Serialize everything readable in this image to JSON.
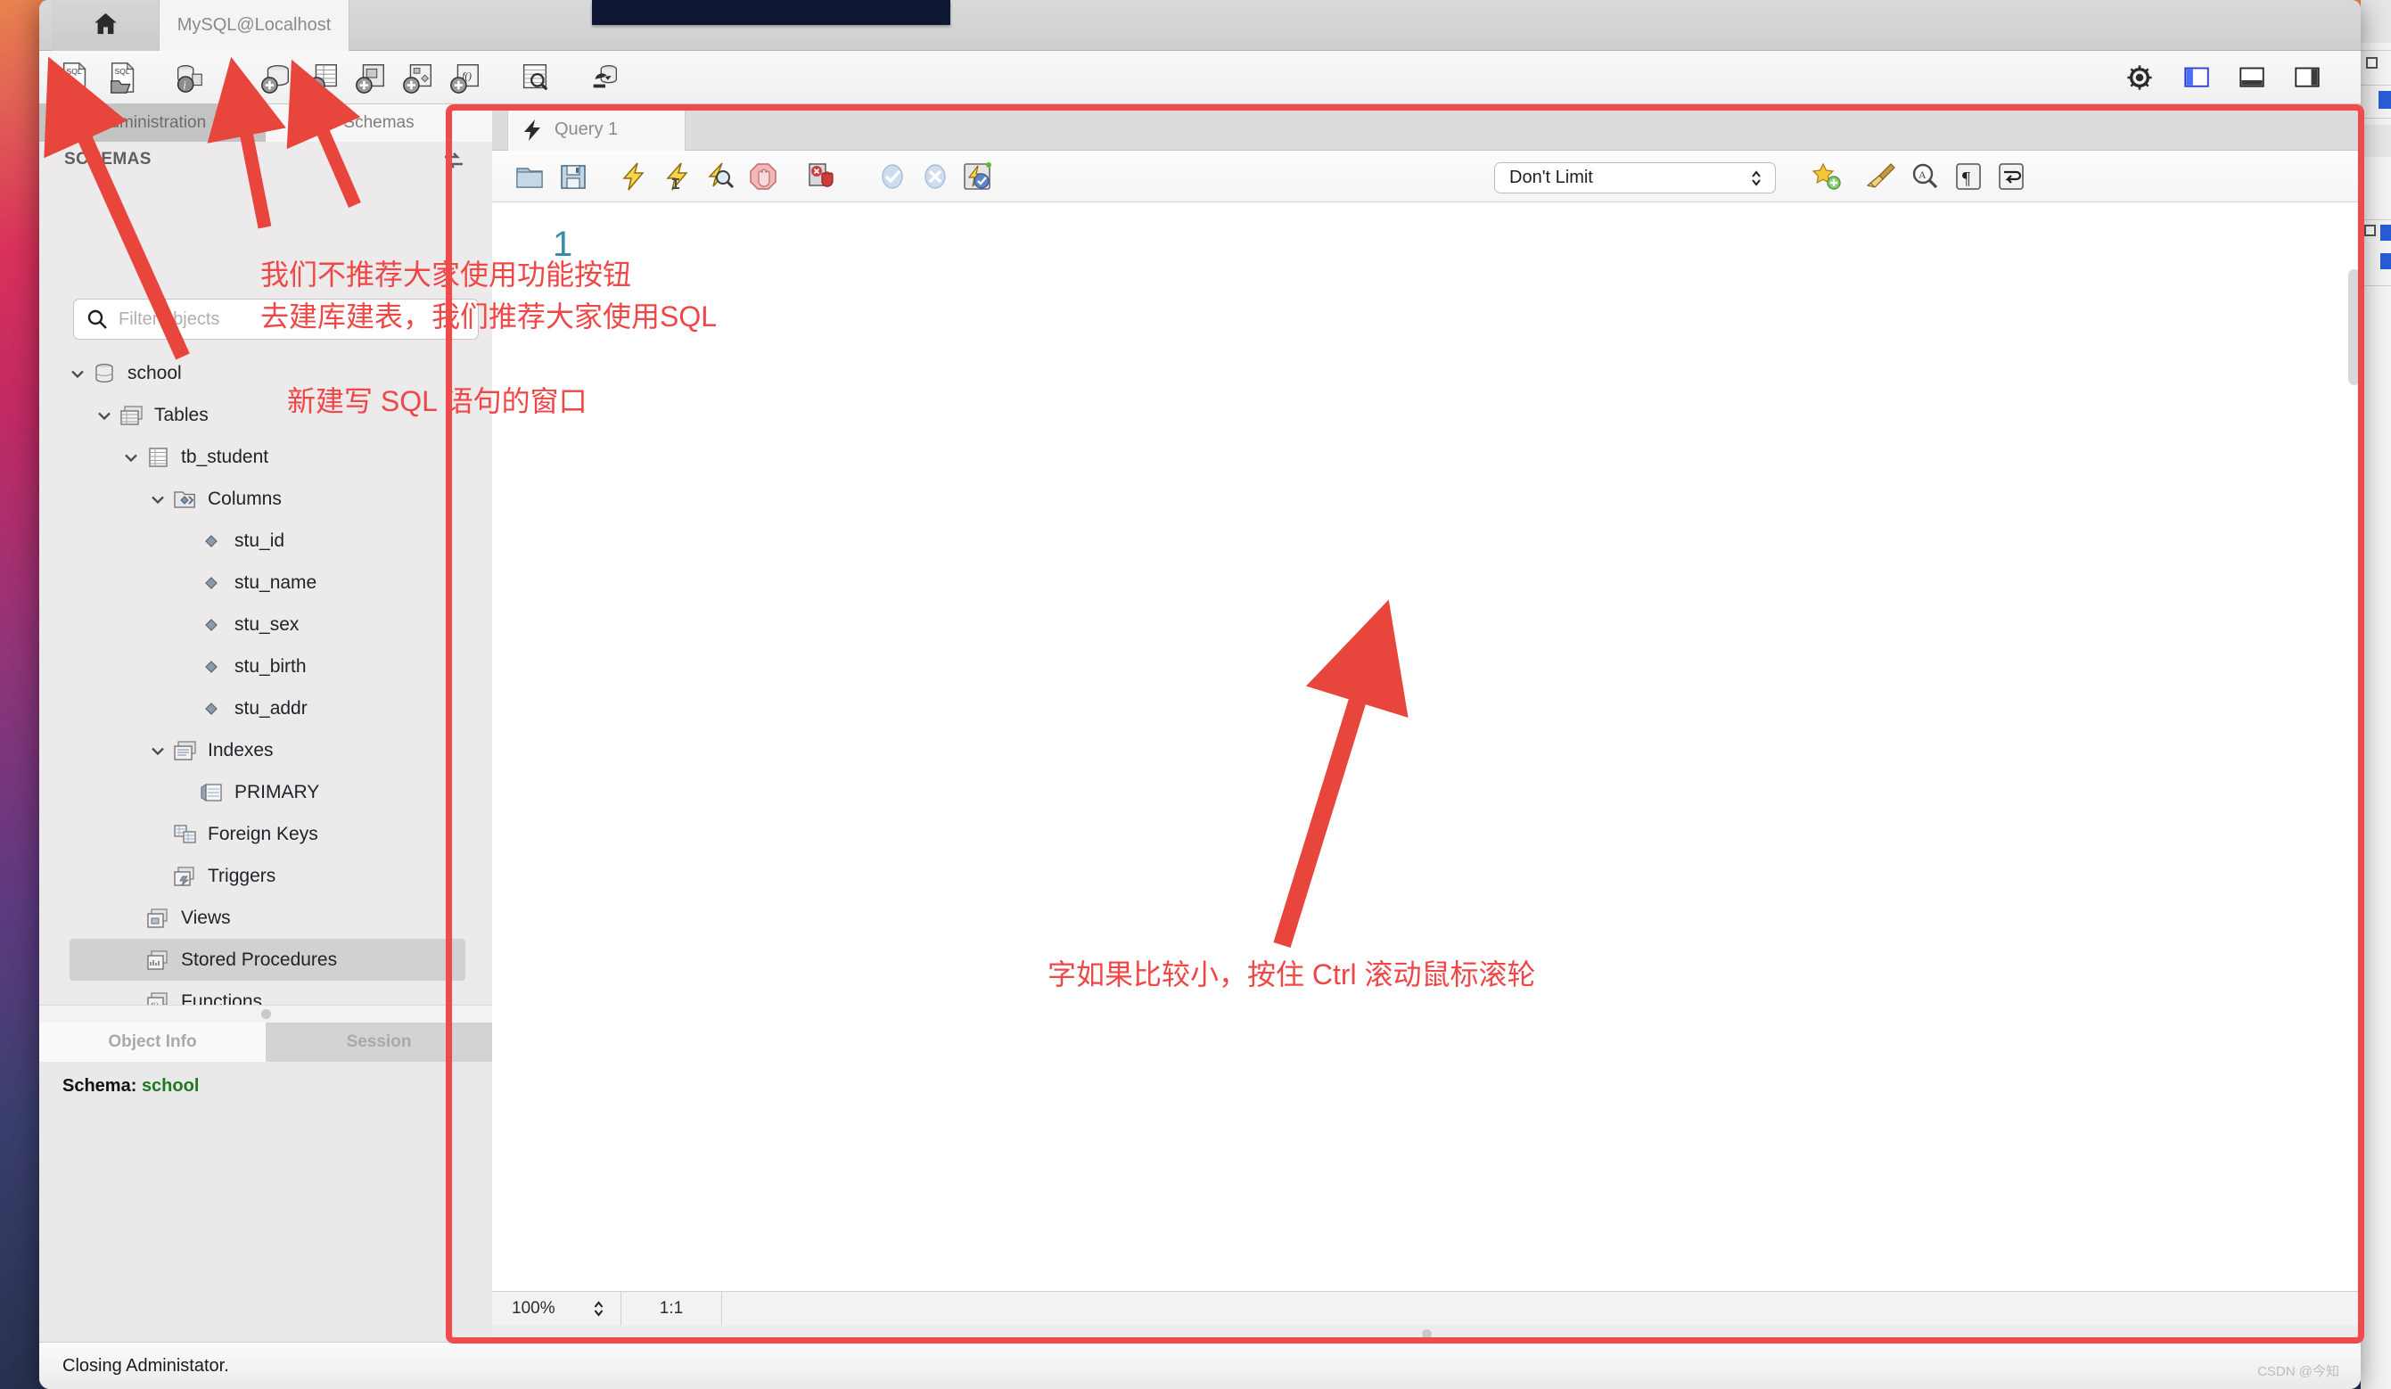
{
  "window": {
    "connection_tab": "MySQL@Localhost",
    "home_icon": "home-icon"
  },
  "main_toolbar": {
    "items": [
      {
        "name": "new-sql-tab-icon",
        "title": "SQL"
      },
      {
        "name": "open-sql-script-icon",
        "title": "SQL"
      },
      {
        "name": "server-info-icon",
        "title": "i"
      },
      {
        "name": "create-schema-icon",
        "title": "+"
      },
      {
        "name": "create-table-icon",
        "title": "+"
      },
      {
        "name": "create-view-icon",
        "title": "+"
      },
      {
        "name": "create-procedure-icon",
        "title": "+"
      },
      {
        "name": "create-function-icon",
        "title": "f()"
      },
      {
        "name": "search-data-icon",
        "title": "search"
      },
      {
        "name": "reconnect-server-icon",
        "title": "reconnect"
      }
    ],
    "right_items": [
      {
        "name": "gear-icon"
      },
      {
        "name": "toggle-sidebar-icon"
      },
      {
        "name": "toggle-output-icon"
      },
      {
        "name": "toggle-secondary-sidebar-icon"
      }
    ]
  },
  "sidebar": {
    "tabs": [
      {
        "label": "Administration",
        "active": true
      },
      {
        "label": "Schemas",
        "active": false
      }
    ],
    "section_title": "SCHEMAS",
    "refresh_icon": "refresh-icon",
    "filter": {
      "placeholder": "Filter objects",
      "value": "",
      "icon": "search-icon"
    },
    "tree": [
      {
        "label": "school",
        "indent": 0,
        "chevron": "down",
        "icon": "database-icon",
        "selected": false
      },
      {
        "label": "Tables",
        "indent": 1,
        "chevron": "down",
        "icon": "tables-icon",
        "selected": false
      },
      {
        "label": "tb_student",
        "indent": 2,
        "chevron": "down",
        "icon": "table-icon",
        "selected": false
      },
      {
        "label": "Columns",
        "indent": 3,
        "chevron": "down",
        "icon": "columns-icon",
        "selected": false
      },
      {
        "label": "stu_id",
        "indent": 4,
        "chevron": "none",
        "icon": "column-icon",
        "selected": false
      },
      {
        "label": "stu_name",
        "indent": 4,
        "chevron": "none",
        "icon": "column-icon",
        "selected": false
      },
      {
        "label": "stu_sex",
        "indent": 4,
        "chevron": "none",
        "icon": "column-icon",
        "selected": false
      },
      {
        "label": "stu_birth",
        "indent": 4,
        "chevron": "none",
        "icon": "column-icon",
        "selected": false
      },
      {
        "label": "stu_addr",
        "indent": 4,
        "chevron": "none",
        "icon": "column-icon",
        "selected": false
      },
      {
        "label": "Indexes",
        "indent": 3,
        "chevron": "down",
        "icon": "indexes-icon",
        "selected": false
      },
      {
        "label": "PRIMARY",
        "indent": 4,
        "chevron": "none",
        "icon": "index-icon",
        "selected": false
      },
      {
        "label": "Foreign Keys",
        "indent": 3,
        "chevron": "none",
        "icon": "foreignkey-icon",
        "selected": false
      },
      {
        "label": "Triggers",
        "indent": 3,
        "chevron": "none",
        "icon": "triggers-icon",
        "selected": false
      },
      {
        "label": "Views",
        "indent": 2,
        "chevron": "none",
        "icon": "views-icon",
        "selected": false
      },
      {
        "label": "Stored Procedures",
        "indent": 2,
        "chevron": "none",
        "icon": "procedures-icon",
        "selected": true
      },
      {
        "label": "Functions",
        "indent": 2,
        "chevron": "none",
        "icon": "functions-icon",
        "selected": false
      }
    ],
    "info_tabs": [
      {
        "label": "Object Info",
        "active": true
      },
      {
        "label": "Session",
        "active": false
      }
    ],
    "object_info": {
      "schema_label": "Schema:",
      "schema_value": "school"
    }
  },
  "editor": {
    "tab": {
      "label": "Query 1",
      "icon": "lightning-icon"
    },
    "toolbar": [
      {
        "name": "open-script-icon"
      },
      {
        "name": "save-script-icon"
      },
      {
        "name": "execute-statement-icon"
      },
      {
        "name": "execute-current-statement-icon"
      },
      {
        "name": "explain-statement-icon"
      },
      {
        "name": "stop-execution-icon"
      },
      {
        "name": "stop-on-error-icon"
      },
      {
        "name": "commit-icon"
      },
      {
        "name": "rollback-icon"
      },
      {
        "name": "toggle-autocommit-icon"
      }
    ],
    "limit_select": {
      "value": "Don't Limit",
      "icon": "chevron-updown-icon"
    },
    "toolbar_right": [
      {
        "name": "add-snippet-icon"
      },
      {
        "name": "beautify-query-icon"
      },
      {
        "name": "find-icon"
      },
      {
        "name": "toggle-invisible-chars-icon"
      },
      {
        "name": "toggle-wrapping-icon"
      }
    ],
    "content": "",
    "status": {
      "zoom": "100%",
      "cursor_position": "1:1"
    }
  },
  "status_bar": {
    "message": "Closing Administator."
  },
  "watermark": "CSDN @今知",
  "annotations": {
    "marker_1": "1",
    "note_toolbar_line1": "我们不推荐大家使用功能按钮",
    "note_toolbar_line2": "去建库建表，我们推荐大家使用SQL",
    "note_new_query": "新建写 SQL 语句的窗口",
    "note_zoom": "字如果比较小，按住 Ctrl 滚动鼠标滚轮"
  },
  "colors": {
    "annotation_red": "#ef4646",
    "marker_blue": "#3d8ba6",
    "highlight_box": "#f04a4a",
    "schema_value_green": "#1e7a1e"
  }
}
